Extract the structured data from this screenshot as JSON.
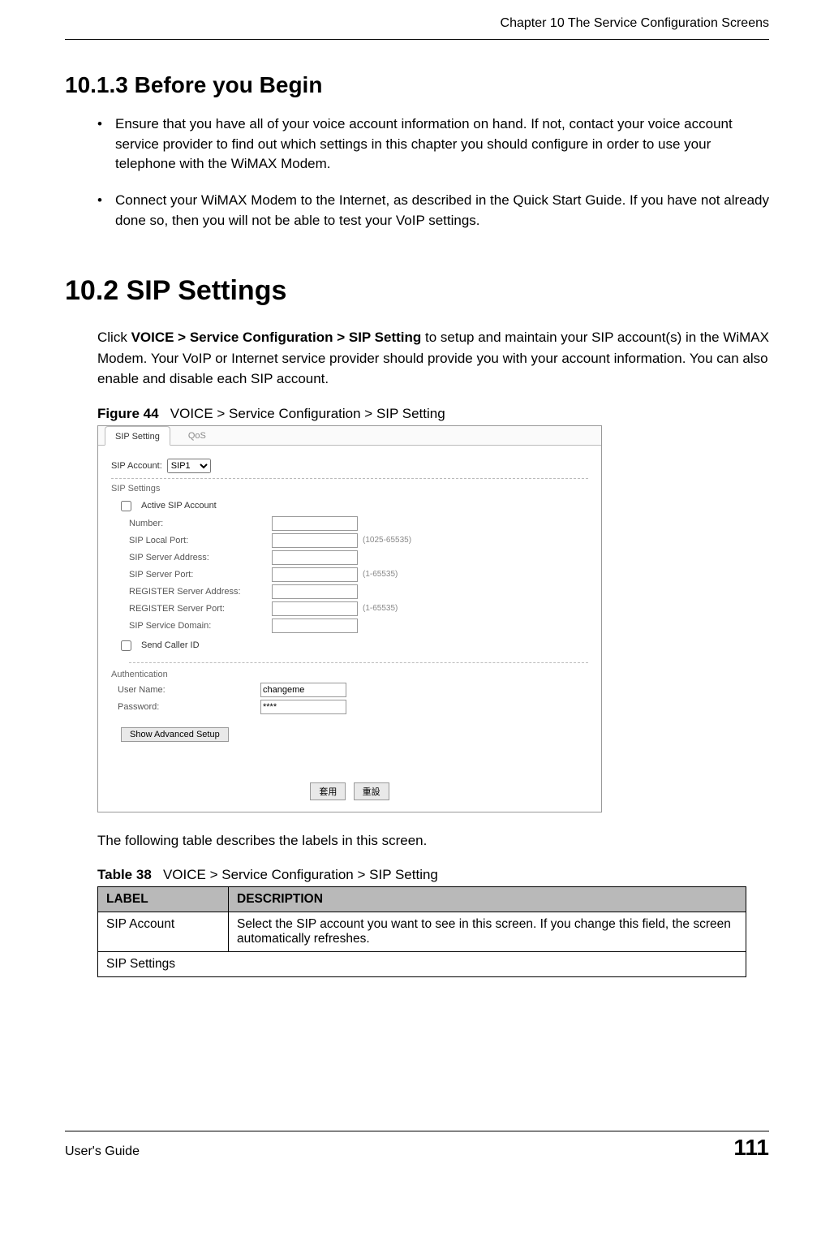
{
  "header": {
    "chapter": "Chapter 10 The Service Configuration Screens"
  },
  "section_10_1_3": {
    "title": "10.1.3  Before you Begin",
    "bullets": [
      "Ensure that you have all of your voice account information on hand. If not, contact your voice account service provider to find out which settings in this chapter you should configure in order to use your telephone with the WiMAX Modem.",
      "Connect your WiMAX Modem to the Internet, as described in the Quick Start Guide. If you have not already done so, then you will not be able to test your VoIP settings."
    ]
  },
  "section_10_2": {
    "title": "10.2  SIP Settings",
    "intro_pre": "Click ",
    "intro_bold": "VOICE > Service Configuration > SIP Setting",
    "intro_post": " to setup and maintain your SIP account(s) in the WiMAX Modem. Your VoIP or Internet service provider should provide you with your account information. You can also enable and disable each SIP account."
  },
  "figure": {
    "caption_label": "Figure 44",
    "caption_text": "VOICE > Service Configuration > SIP Setting",
    "tabs": {
      "sip_setting": "SIP Setting",
      "qos": "QoS"
    },
    "sip_account_label": "SIP Account:",
    "sip_account_value": "SIP1",
    "section_sip_settings": "SIP Settings",
    "active_sip": "Active SIP Account",
    "fields": {
      "number": "Number:",
      "sip_local_port": "SIP Local Port:",
      "sip_local_port_hint": "(1025-65535)",
      "sip_server_addr": "SIP Server Address:",
      "sip_server_port": "SIP Server Port:",
      "sip_server_port_hint": "(1-65535)",
      "reg_server_addr": "REGISTER Server Address:",
      "reg_server_port": "REGISTER Server Port:",
      "reg_server_port_hint": "(1-65535)",
      "sip_service_domain": "SIP Service Domain:"
    },
    "send_caller_id": "Send Caller ID",
    "section_auth": "Authentication",
    "auth": {
      "user_name_label": "User Name:",
      "user_name_value": "changeme",
      "password_label": "Password:",
      "password_value": "****"
    },
    "buttons": {
      "advanced": "Show Advanced Setup",
      "apply": "套用",
      "reset": "重設"
    }
  },
  "after_figure": "The following table describes the labels in this screen.",
  "table": {
    "caption_label": "Table 38",
    "caption_text": "VOICE > Service Configuration > SIP Setting",
    "headers": {
      "label": "LABEL",
      "desc": "DESCRIPTION"
    },
    "rows": [
      {
        "label": "SIP Account",
        "desc": "Select the SIP account you want to see in this screen. If you change this field, the screen automatically refreshes."
      },
      {
        "label": "SIP Settings",
        "desc": ""
      }
    ]
  },
  "footer": {
    "left": "User's Guide",
    "page": "111"
  }
}
